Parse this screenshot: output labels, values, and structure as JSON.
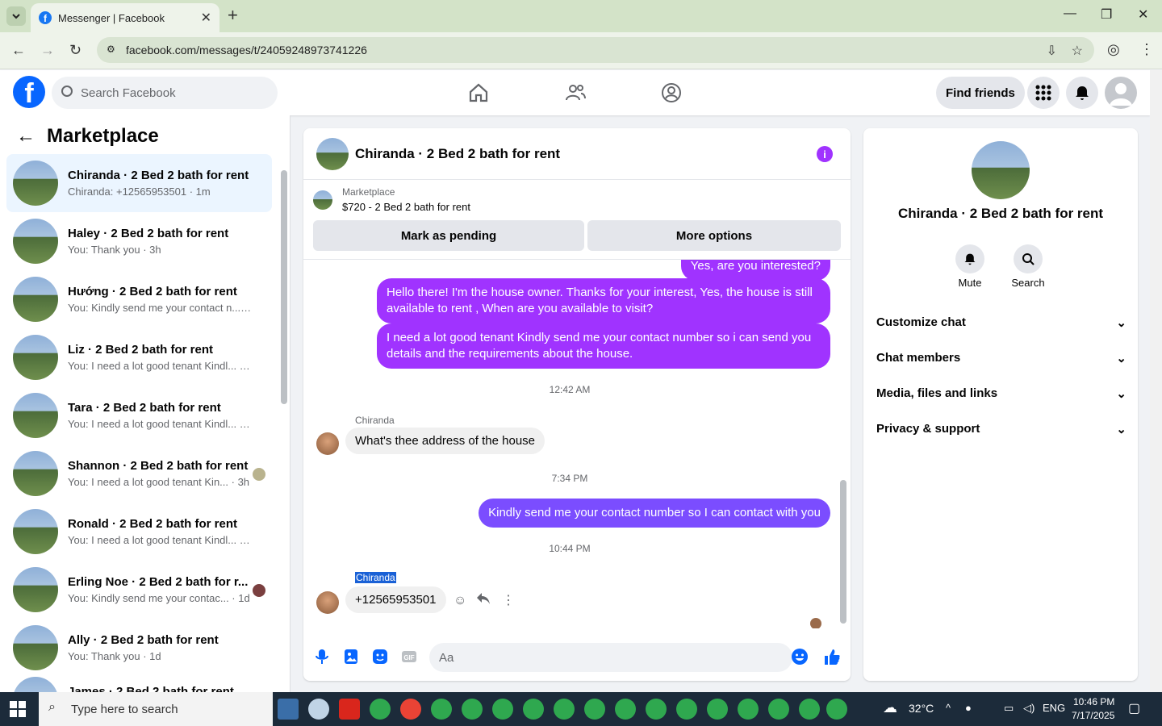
{
  "browser": {
    "tab_title": "Messenger | Facebook",
    "url": "facebook.com/messages/t/24059248973741226"
  },
  "header": {
    "search_placeholder": "Search Facebook",
    "find_friends": "Find friends"
  },
  "sidebar": {
    "title": "Marketplace",
    "conversations": [
      {
        "name": "Chiranda · 2 Bed 2 bath for rent",
        "preview": "Chiranda: +12565953501 · 1m"
      },
      {
        "name": "Haley · 2 Bed 2 bath for rent",
        "preview": "You: Thank you · 3h"
      },
      {
        "name": "Hướng · 2 Bed 2 bath for rent",
        "preview": "You: Kindly send me your contact n... · 3h"
      },
      {
        "name": "Liz · 2 Bed 2 bath for rent",
        "preview": "You: I need a lot good tenant Kindl... · 3h"
      },
      {
        "name": "Tara · 2 Bed 2 bath for rent",
        "preview": "You: I need a lot good tenant Kindl... · 3h"
      },
      {
        "name": "Shannon · 2 Bed 2 bath for rent",
        "preview": "You: I need a lot good tenant Kin... · 3h"
      },
      {
        "name": "Ronald · 2 Bed 2 bath for rent",
        "preview": "You: I need a lot good tenant Kindl... · 3h"
      },
      {
        "name": "Erling Noe · 2 Bed 2 bath for r...",
        "preview": "You: Kindly send me your contac... · 1d"
      },
      {
        "name": "Ally · 2 Bed 2 bath for rent",
        "preview": "You: Thank you · 1d"
      },
      {
        "name": "James · 2 Bed 2 bath for rent",
        "preview": ""
      }
    ]
  },
  "chat": {
    "title": "Chiranda · 2 Bed 2 bath for rent",
    "listing_source": "Marketplace",
    "listing_title": "$720 - 2 Bed 2 bath for rent",
    "mark_pending": "Mark as pending",
    "more_options": "More options",
    "messages": {
      "m0": "Yes, are you interested?",
      "m1": "Hello there! I'm the house owner. Thanks for your interest, Yes, the house is still available to rent , When are you available to visit?",
      "m2": "I need a lot good tenant Kindly send me your contact number so i can send you details and the requirements about the house.",
      "t1": "12:42 AM",
      "s1": "Chiranda",
      "m3": "What's thee address of the house",
      "t2": "7:34 PM",
      "m4": "Kindly send me your contact number so I can contact with you",
      "t3": "10:44 PM",
      "s2": "Chiranda",
      "m5": "+12565953501"
    },
    "composer_placeholder": "Aa"
  },
  "details": {
    "name": "Chiranda · 2 Bed 2 bath for rent",
    "mute": "Mute",
    "search": "Search",
    "sections": [
      "Customize chat",
      "Chat members",
      "Media, files and links",
      "Privacy & support"
    ]
  },
  "taskbar": {
    "search_placeholder": "Type here to search",
    "weather": "32°C",
    "lang": "ENG",
    "time": "10:46 PM",
    "date": "7/17/2025"
  },
  "colors": {
    "accent": "#a033ff",
    "fb_blue": "#0866ff"
  }
}
